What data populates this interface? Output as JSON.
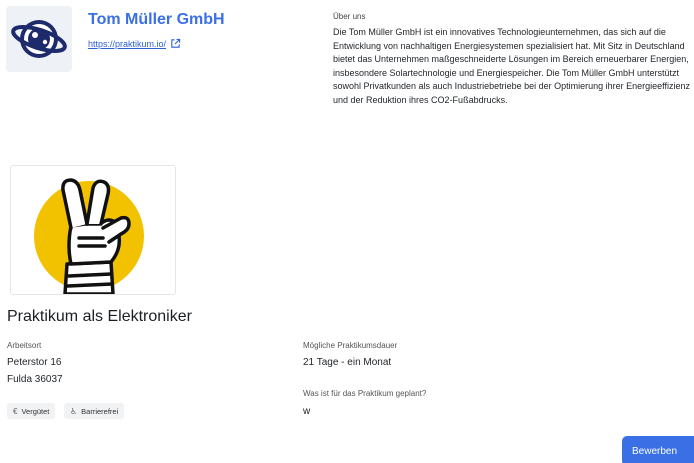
{
  "company": {
    "name": "Tom Müller GmbH",
    "link": "https://praktikum.io/"
  },
  "about": {
    "title": "Über uns",
    "text": "Die Tom Müller GmbH ist ein innovatives Technologieunternehmen, das sich auf die Entwicklung von nachhaltigen Energiesystemen spezialisiert hat. Mit Sitz in Deutschland bietet das Unternehmen maßgeschneiderte Lösungen im Bereich erneuerbarer Energien, insbesondere Solartechnologie und Energiespeicher. Die Tom Müller GmbH unterstützt sowohl Privatkunden als auch Industriebetriebe bei der Optimierung ihrer Energieeffizienz und der Reduktion ihres CO2-Fußabdrucks."
  },
  "job": {
    "title": "Praktikum als Elektroniker",
    "location_label": "Arbeitsort",
    "street": "Peterstor 16",
    "city": "Fulda 36037",
    "duration_label": "Mögliche Praktikumsdauer",
    "duration": "21 Tage - ein Monat",
    "plan_label": "Was ist für das Praktikum geplant?",
    "plan": "w"
  },
  "tags": [
    {
      "icon": "euro-icon",
      "glyph": "€",
      "label": "Vergütet"
    },
    {
      "icon": "accessibility-icon",
      "glyph": "♿",
      "label": "Barrierefrei"
    }
  ],
  "apply_label": "Bewerben",
  "colors": {
    "accent": "#3b6fe6",
    "hero_circle": "#f2c200",
    "logo_navy": "#1d2a6b"
  }
}
